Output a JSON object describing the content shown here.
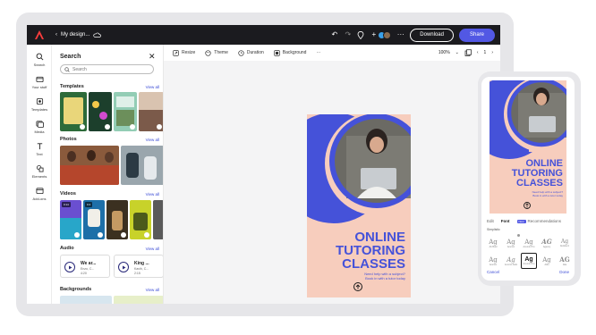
{
  "topbar": {
    "breadcrumb": "My design...",
    "download_label": "Download",
    "share_label": "Share"
  },
  "rail": {
    "items": [
      {
        "label": "Search",
        "icon": "search-icon"
      },
      {
        "label": "Your stuff",
        "icon": "folder-icon"
      },
      {
        "label": "Templates",
        "icon": "templates-icon"
      },
      {
        "label": "Media",
        "icon": "media-icon"
      },
      {
        "label": "Text",
        "icon": "text-icon"
      },
      {
        "label": "Elements",
        "icon": "elements-icon"
      },
      {
        "label": "Add-ons",
        "icon": "add-ons-icon"
      }
    ]
  },
  "panel": {
    "title": "Search",
    "search_placeholder": "Search",
    "sections": {
      "templates": {
        "title": "Templates",
        "view_all": "View all"
      },
      "photos": {
        "title": "Photos",
        "view_all": "View all"
      },
      "videos": {
        "title": "Videos",
        "view_all": "View all",
        "durations": [
          "0:14",
          "0:4"
        ]
      },
      "audio": {
        "title": "Audio",
        "view_all": "View all"
      },
      "backgrounds": {
        "title": "Backgrounds",
        "view_all": "View all"
      }
    },
    "audio_tracks": [
      {
        "title": "We ar...",
        "artist": "Enzo, C...",
        "duration": "4:20"
      },
      {
        "title": "King ...",
        "artist": "Kavih, C...",
        "duration": "2:15"
      }
    ]
  },
  "canvas_toolbar": {
    "resize": "Resize",
    "theme": "Theme",
    "duration": "Duration",
    "background": "Background",
    "zoom": "100%",
    "page": "1"
  },
  "poster": {
    "title_lines": [
      "ONLINE",
      "TUTORING",
      "CLASSES"
    ],
    "subtitle_lines": [
      "Need help with a subject?",
      "Book in with a tutor today"
    ]
  },
  "phone": {
    "tabs": [
      "Edit",
      "Font",
      "Recommendations"
    ],
    "badge": "New",
    "row_label": "Simplistic",
    "font_tiles": [
      {
        "ag": "Ag",
        "name": "Ab Bold"
      },
      {
        "ag": "Ag",
        "name": "Acumin"
      },
      {
        "ag": "Ag",
        "name": "Acumin Pro"
      },
      {
        "ag": "AG",
        "name": "Agency"
      },
      {
        "ag": "Ag",
        "name": "Akzidenz"
      },
      {
        "ag": "Ag",
        "name": "Acumin"
      },
      {
        "ag": "Ag",
        "name": "Acumin Italic"
      },
      {
        "ag": "Ag",
        "name": "Acumin Pro"
      },
      {
        "ag": "Ag",
        "name": "Aldo"
      },
      {
        "ag": "AG",
        "name": "Alia"
      }
    ],
    "cancel_label": "Cancel",
    "done_label": "Done"
  },
  "colors": {
    "accent": "#5258e4",
    "poster_bg": "#f7cdbd",
    "poster_blue": "#4552d9",
    "topbar": "#1b1b1f"
  }
}
